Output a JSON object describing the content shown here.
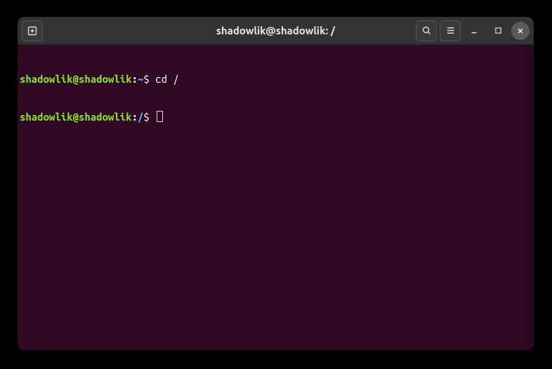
{
  "titlebar": {
    "newtab_icon": "new-tab-icon",
    "title": "shadowlik@shadowlik: /",
    "search_icon": "search-icon",
    "menu_icon": "hamburger-menu-icon",
    "minimize_icon": "minimize-icon",
    "maximize_icon": "maximize-icon",
    "close_icon": "close-icon"
  },
  "terminal": {
    "lines": [
      {
        "user": "shadowlik@shadowlik",
        "colon": ":",
        "path": "~",
        "prompt": "$ ",
        "command": "cd /"
      },
      {
        "user": "shadowlik@shadowlik",
        "colon": ":",
        "path": "/",
        "prompt": "$ ",
        "command": "",
        "cursor": true
      }
    ]
  },
  "colors": {
    "terminal_bg": "#300a24",
    "prompt_user": "#8ae234",
    "prompt_path": "#729fcf",
    "text": "#ffffff"
  }
}
